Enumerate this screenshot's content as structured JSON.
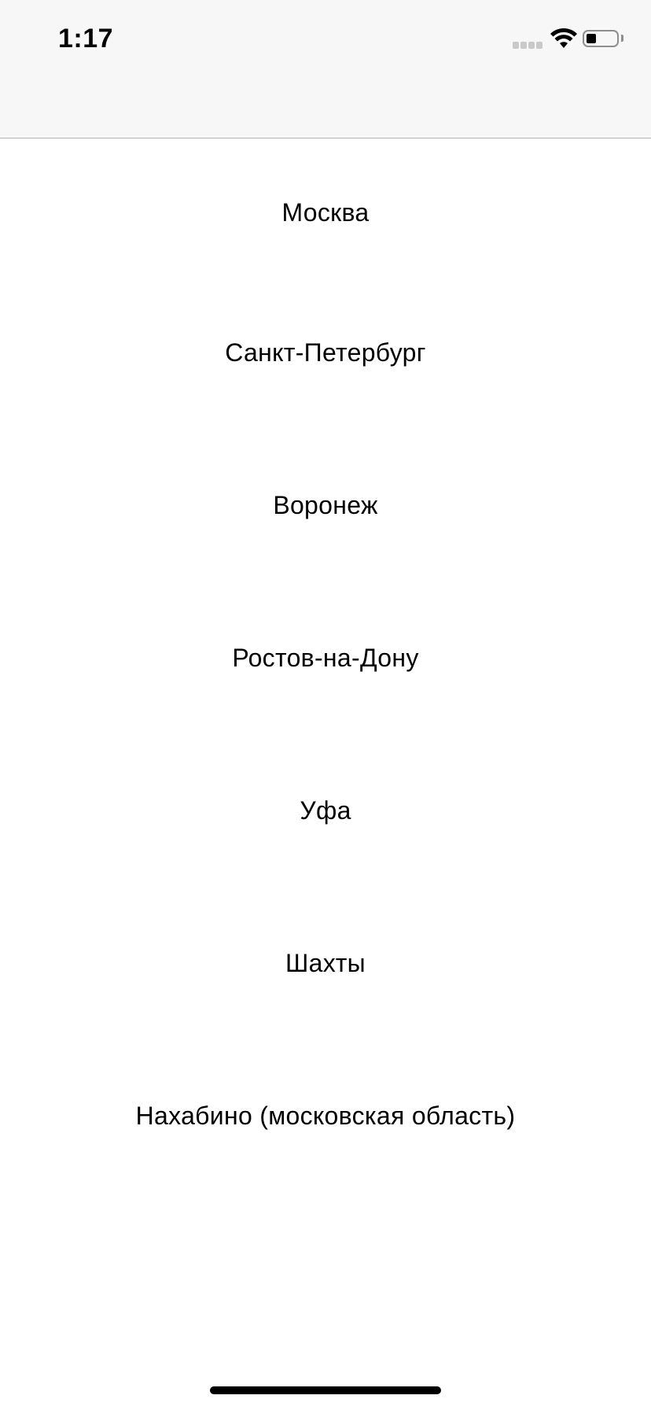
{
  "status_bar": {
    "time": "1:17",
    "icons": [
      "cellular-signal-icon",
      "wifi-icon",
      "battery-icon"
    ]
  },
  "cities": [
    "Москва",
    "Санкт-Петербург",
    "Воронеж",
    "Ростов-на-Дону",
    "Уфа",
    "Шахты",
    "Нахабино (московская область)"
  ]
}
